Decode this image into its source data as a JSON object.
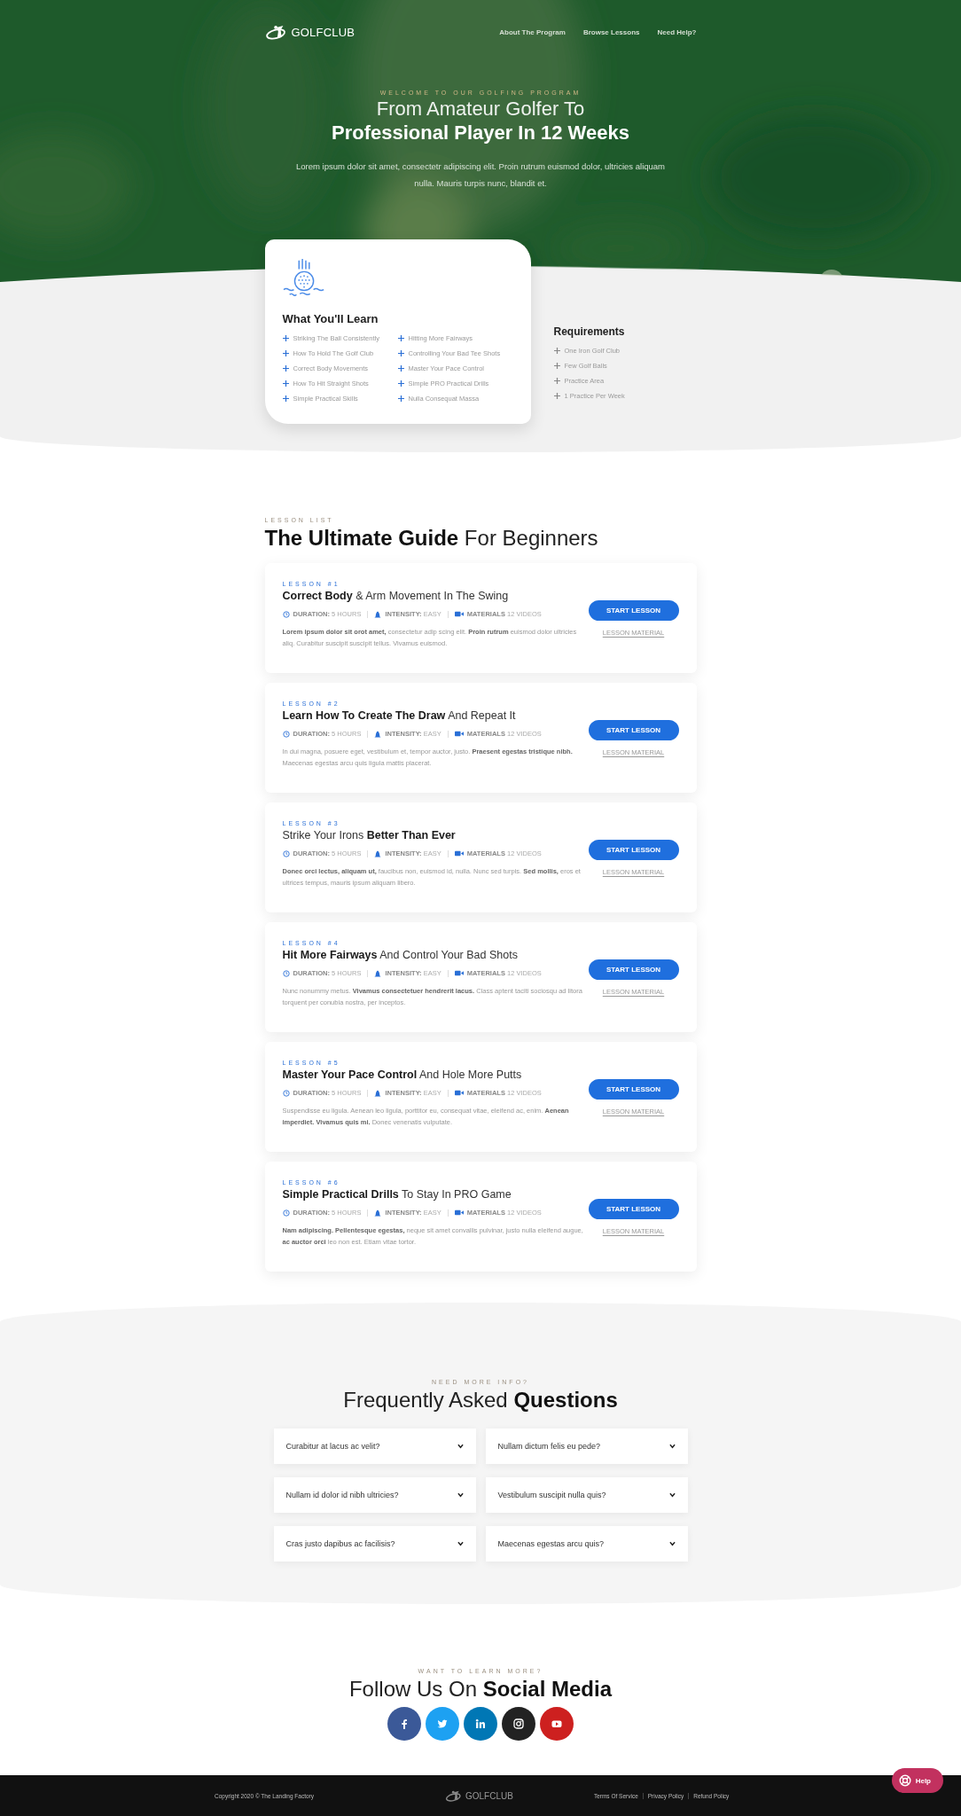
{
  "nav": {
    "logo": "**GOLF**CLUB",
    "links": [
      "About The Program",
      "Browse Lessons",
      "Need Help?"
    ]
  },
  "hero": {
    "eyebrow": "WELCOME TO OUR GOLFING PROGRAM",
    "title_light": "From Amateur Golfer To",
    "title_bold": "Professional Player In 12 Weeks",
    "text": "Lorem ipsum dolor sit amet, consectetr adipiscing elit. Proin rutrum euismod dolor, ultricies aliquam nulla. Mauris turpis nunc, blandit et."
  },
  "learn": {
    "title": "What You'll Learn",
    "items": [
      "Striking The Ball Consistently",
      "How To Hold The Golf Club",
      "Correct Body Movements",
      "How To Hit Straight Shots",
      "Simple Practical Skills",
      "Hitting More Fairways",
      "Controlling Your Bad Tee Shots",
      "Master Your Pace Control",
      "Simple PRO Practical Drills",
      "Nulla Consequat Massa"
    ]
  },
  "requirements": {
    "title": "Requirements",
    "items": [
      "One Iron Golf Club",
      "Few Golf Balls",
      "Practice Area",
      "1 Practice Per Week"
    ]
  },
  "lessons": {
    "eyebrow": "LESSON LIST",
    "title": "**The Ultimate Guide** For Beginners",
    "items": [
      {
        "label": "LESSON #1",
        "title": "**Correct Body** & Arm Movement In The Swing",
        "meta": [
          {
            "kind": "duration",
            "label": "DURATION:",
            "value": "5 HOURS"
          },
          {
            "kind": "intensity",
            "label": "INTENSITY:",
            "value": "EASY"
          },
          {
            "kind": "materials",
            "label": "MATERIALS",
            "value": "12 VIDEOS"
          }
        ],
        "text": "**Lorem ipsum dolor sit orot amet,** consectetur adip scing elit. **Proin rutrum** euismod dolor ultricies aliq. Curabitur suscipit suscipit tellus. Vivamus euismod.",
        "button": "START LESSON",
        "link": "LESSON MATERIAL"
      },
      {
        "label": "LESSON #2",
        "title": "**Learn How To Create The Draw** And Repeat It",
        "meta": [
          {
            "kind": "duration",
            "label": "DURATION:",
            "value": "5 HOURS"
          },
          {
            "kind": "intensity",
            "label": "INTENSITY:",
            "value": "EASY"
          },
          {
            "kind": "materials",
            "label": "MATERIALS",
            "value": "12 VIDEOS"
          }
        ],
        "text": "In dui magna, posuere eget, vestibulum et, tempor auctor, justo. **Praesent egestas tristique nibh.** Maecenas egestas arcu quis ligula mattis placerat.",
        "button": "START LESSON",
        "link": "LESSON MATERIAL"
      },
      {
        "label": "LESSON #3",
        "title": "Strike Your Irons **Better Than Ever**",
        "meta": [
          {
            "kind": "duration",
            "label": "DURATION:",
            "value": "5 HOURS"
          },
          {
            "kind": "intensity",
            "label": "INTENSITY:",
            "value": "EASY"
          },
          {
            "kind": "materials",
            "label": "MATERIALS",
            "value": "12 VIDEOS"
          }
        ],
        "text": "**Donec orci lectus, aliquam ut,** faucibus non, euismod id, nulla. Nunc sed turpis. **Sed mollis,** eros et ultrices tempus, mauris ipsum aliquam libero.",
        "button": "START LESSON",
        "link": "LESSON MATERIAL"
      },
      {
        "label": "LESSON #4",
        "title": "**Hit More Fairways** And Control Your Bad Shots",
        "meta": [
          {
            "kind": "duration",
            "label": "DURATION:",
            "value": "5 HOURS"
          },
          {
            "kind": "intensity",
            "label": "INTENSITY:",
            "value": "EASY"
          },
          {
            "kind": "materials",
            "label": "MATERIALS",
            "value": "12 VIDEOS"
          }
        ],
        "text": "Nunc nonummy metus. **Vivamus consectetuer hendrerit lacus.** Class aptent taciti sociosqu ad litora torquent per conubia nostra, per inceptos.",
        "button": "START LESSON",
        "link": "LESSON MATERIAL"
      },
      {
        "label": "LESSON #5",
        "title": "**Master Your Pace Control** And Hole More Putts",
        "meta": [
          {
            "kind": "duration",
            "label": "DURATION:",
            "value": "5 HOURS"
          },
          {
            "kind": "intensity",
            "label": "INTENSITY:",
            "value": "EASY"
          },
          {
            "kind": "materials",
            "label": "MATERIALS",
            "value": "12 VIDEOS"
          }
        ],
        "text": "Suspendisse eu ligula. Aenean leo ligula, porttitor eu, consequat vitae, eleifend ac, enim. **Aenean imperdiet. Vivamus quis mi.** Donec venenatis vulputate.",
        "button": "START LESSON",
        "link": "LESSON MATERIAL"
      },
      {
        "label": "LESSON #6",
        "title": "**Simple Practical Drills** To Stay In PRO Game",
        "meta": [
          {
            "kind": "duration",
            "label": "DURATION:",
            "value": "5 HOURS"
          },
          {
            "kind": "intensity",
            "label": "INTENSITY:",
            "value": "EASY"
          },
          {
            "kind": "materials",
            "label": "MATERIALS",
            "value": "12 VIDEOS"
          }
        ],
        "text": "**Nam adipiscing. Pellentesque egestas,** neque sit amet convallis pulvinar, justo nulla eleifend augue, **ac auctor orci** leo non est. Etiam vitae tortor.",
        "button": "START LESSON",
        "link": "LESSON MATERIAL"
      }
    ]
  },
  "faq": {
    "eyebrow": "NEED MORE INFO?",
    "title": "Frequently Asked **Questions**",
    "questions": [
      {
        "text": "Curabitur at lacus ac velit?",
        "expanded": false
      },
      {
        "text": "Nullam dictum felis eu pede?",
        "expanded": false
      },
      {
        "text": "Nullam id dolor id nibh ultricies?",
        "expanded": false
      },
      {
        "text": "Vestibulum suscipit nulla quis?",
        "expanded": false
      },
      {
        "text": "Cras justo dapibus ac facilisis?",
        "expanded": false
      },
      {
        "text": "Maecenas egestas arcu quis?",
        "expanded": false
      }
    ]
  },
  "social": {
    "eyebrow": "WANT TO LEARN MORE?",
    "title": "Follow Us On **Social Media**",
    "networks": [
      {
        "kind": "facebook",
        "color": "#3b5998"
      },
      {
        "kind": "twitter",
        "color": "#1da1f2"
      },
      {
        "kind": "linkedin",
        "color": "#0077b5"
      },
      {
        "kind": "instagram",
        "color": "#222222"
      },
      {
        "kind": "youtube",
        "color": "#cd201f"
      }
    ]
  },
  "footer": {
    "copyright": "Copyright 2020 © The Landing Factory",
    "logo": "**GOLF**CLUB",
    "links": [
      "Terms Of Service",
      "Privacy Policy",
      "Refund Policy"
    ]
  },
  "help_button": "Help"
}
